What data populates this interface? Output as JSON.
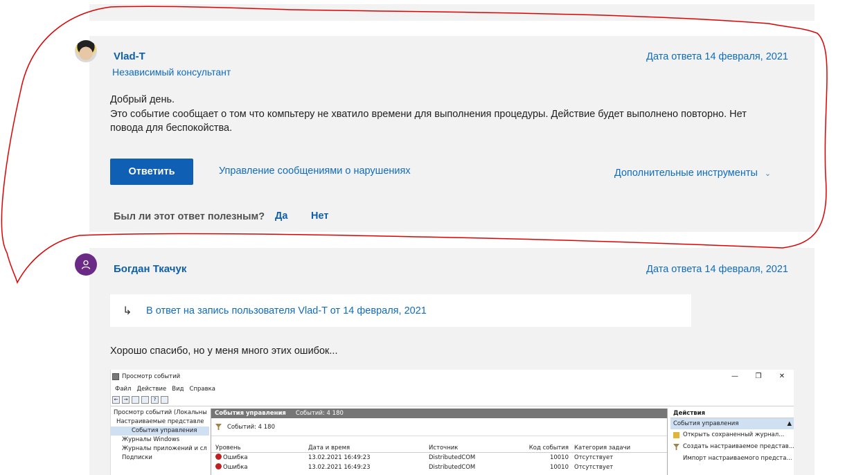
{
  "post1": {
    "author": "Vlad-T",
    "role": "Независимый консультант",
    "date": "Дата ответа 14 февраля, 2021",
    "body_lines": [
      "Добрый день.",
      "Это событие сообщает о том что компьтеру не хватило времени для выполнения процедуры. Действие будет выполнено повторно. Нет",
      "повода для беспокойства."
    ],
    "reply_label": "Ответить",
    "report_link": "Управление сообщениями о нарушениях",
    "tools_label": "Дополнительные инструменты",
    "helpful_question": "Был ли этот ответ полезным?",
    "yes": "Да",
    "no": "Нет"
  },
  "post2": {
    "author": "Богдан Ткачук",
    "date": "Дата ответа 14 февраля, 2021",
    "quote": "В ответ на запись пользователя Vlad-T от 14 февраля, 2021",
    "text": "Хорошо спасибо, но у меня много этих ошибок..."
  },
  "screenshot": {
    "title": "Просмотр событий",
    "menu": [
      "Файл",
      "Действие",
      "Вид",
      "Справка"
    ],
    "tree": [
      "Просмотр событий (Локальны",
      "Настраиваемые представле",
      "События управления",
      "Журналы Windows",
      "Журналы приложений и сл",
      "Подписки"
    ],
    "center_title": "События управления",
    "center_count": "Событий: 4 180",
    "filter_count": "Событий: 4 180",
    "columns": [
      "Уровень",
      "Дата и время",
      "Источник",
      "Код события",
      "Категория задачи"
    ],
    "rows": [
      [
        "Ошибка",
        "13.02.2021 16:49:23",
        "DistributedCOM",
        "10010",
        "Отсутствует"
      ],
      [
        "Ошибка",
        "13.02.2021 16:49:23",
        "DistributedCOM",
        "10010",
        "Отсутствует"
      ]
    ],
    "actions_title": "Действия",
    "actions_sub": "События управления",
    "actions": [
      "Открыть сохраненный журнал...",
      "Создать настраиваемое представ...",
      "Импорт настраиваемого предста..."
    ]
  },
  "colors": {
    "link": "#0f6cbd",
    "button": "#0f5fb5",
    "panel": "#f2f2f2",
    "annotation": "#e00000"
  }
}
